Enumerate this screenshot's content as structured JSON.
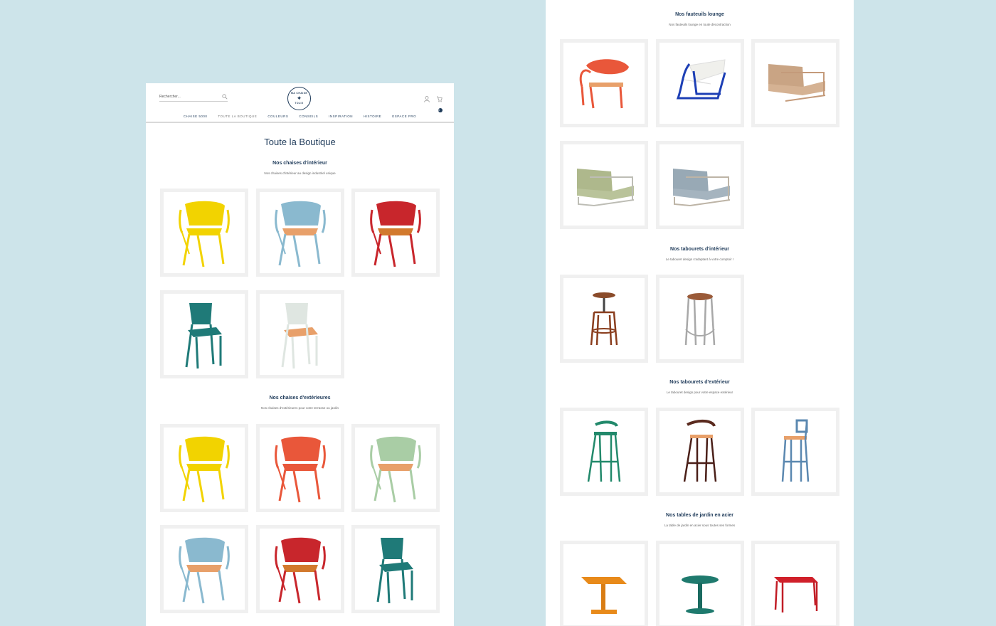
{
  "header": {
    "search_placeholder": "Rechercher...",
    "logo_top": "MA CHAISE",
    "logo_mid": "✦",
    "logo_bottom": "TOLIX",
    "cart_count": "0",
    "nav": [
      "CHAISE 5000",
      "TOUTE LA BOUTIQUE",
      "COULEURS",
      "CONSEILS",
      "INSPIRATION",
      "HISTOIRE",
      "ESPACE PRO"
    ]
  },
  "page_title": "Toute la Boutique",
  "sections_left": [
    {
      "title": "Nos chaises d'intérieur",
      "subtitle": "Nos chaises d'intérieur au design industriel unique"
    },
    {
      "title": "Nos chaises d'extérieures",
      "subtitle": "Nos chaises d'extérieures pour votre terrasse ou jardin"
    }
  ],
  "sections_right": [
    {
      "title": "Nos fauteuils lounge",
      "subtitle": "Nos fauteuils lounge en toute décontraction"
    },
    {
      "title": "Nos tabourets d'intérieur",
      "subtitle": "Le tabouret design s'adaptant à votre comptoir !"
    },
    {
      "title": "Nos tabourets d'extérieur",
      "subtitle": "Le tabouret design pour votre espace extérieur"
    },
    {
      "title": "Nos tables de jardin en acier",
      "subtitle": "La table de jardin en acier sous toutes ses formes"
    }
  ],
  "colors": {
    "background": "#cde4ea",
    "brand": "#1f3b5a",
    "yellow": "#f2d300",
    "light_blue": "#8ab9cf",
    "red": "#c8262c",
    "teal": "#1f7a78",
    "white_chair": "#e8ece9",
    "orange": "#e9573a",
    "sage": "#a9cda5",
    "green": "#22896b",
    "brown": "#5a2a1e",
    "steel_blue": "#5b88b0",
    "wood": "#e8a06a"
  },
  "products": {
    "interior_chairs": [
      "yellow",
      "light_blue",
      "red",
      "teal",
      "white_chair"
    ],
    "exterior_chairs": [
      "yellow",
      "orange",
      "sage",
      "light_blue",
      "red",
      "teal"
    ],
    "lounge": [
      "orange-lounge",
      "white-blue-lounge",
      "beige-lounge",
      "sage-lounge",
      "grey-lounge"
    ],
    "stools_interior": [
      "brown-screw-stool",
      "grey-wood-stool"
    ],
    "stools_exterior": [
      "green-bar-stool",
      "brown-bar-stool",
      "blue-bar-stool"
    ],
    "tables": [
      "orange-table",
      "teal-table",
      "red-table"
    ]
  }
}
